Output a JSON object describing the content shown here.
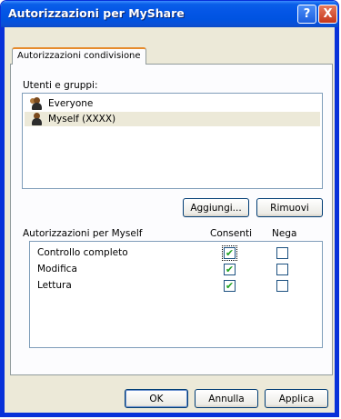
{
  "window": {
    "title": "Autorizzazioni per MyShare",
    "help_label": "?",
    "close_label": "X"
  },
  "tabs": [
    {
      "label": "Autorizzazioni condivisione"
    }
  ],
  "users_group": {
    "label": "Utenti e gruppi:",
    "items": [
      {
        "label": "Everyone",
        "icon": "group-icon",
        "selected": false
      },
      {
        "label": "Myself (XXXX)",
        "icon": "user-icon",
        "selected": true
      }
    ]
  },
  "buttons": {
    "add": "Aggiungi...",
    "remove": "Rimuovi",
    "ok": "OK",
    "cancel": "Annulla",
    "apply": "Applica"
  },
  "permissions": {
    "header": "Autorizzazioni per Myself",
    "allow_header": "Consenti",
    "deny_header": "Nega",
    "rows": [
      {
        "label": "Controllo completo",
        "allow": true,
        "deny": false
      },
      {
        "label": "Modifica",
        "allow": true,
        "deny": false
      },
      {
        "label": "Lettura",
        "allow": true,
        "deny": false
      }
    ]
  },
  "colors": {
    "titlebar": "#0053e1",
    "tab_accent": "#e68b2c",
    "check_mark": "#21a121"
  }
}
